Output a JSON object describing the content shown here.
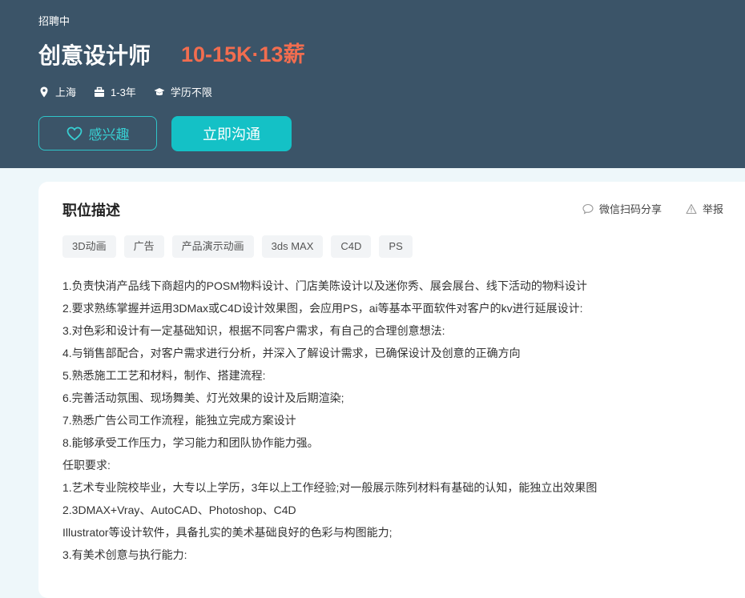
{
  "header": {
    "status": "招聘中",
    "title": "创意设计师",
    "salary": "10-15K·13薪",
    "meta": {
      "location": "上海",
      "experience": "1-3年",
      "education": "学历不限"
    },
    "interest_button": "感兴趣",
    "chat_button": "立即沟通",
    "icons": {
      "location": "location-pin-icon",
      "experience": "briefcase-icon",
      "education": "graduation-cap-icon",
      "interest": "heart-icon"
    }
  },
  "card": {
    "section_title": "职位描述",
    "actions": {
      "share": "微信扫码分享",
      "report": "举报"
    },
    "action_icons": {
      "share": "chat-bubble-icon",
      "report": "warning-triangle-icon"
    },
    "tags": [
      "3D动画",
      "广告",
      "产品演示动画",
      "3ds MAX",
      "C4D",
      "PS"
    ],
    "description": [
      "1.负责快消产品线下商超内的POSM物料设计、门店美陈设计以及迷你秀、展会展台、线下活动的物料设计",
      "2.要求熟练掌握并运用3DMax或C4D设计效果图，会应用PS，ai等基本平面软件对客户的kv进行延展设计:",
      "3.对色彩和设计有一定基础知识，根据不同客户需求，有自己的合理创意想法:",
      "4.与销售部配合，对客户需求进行分析，并深入了解设计需求，已确保设计及创意的正确方向",
      "5.熟悉施工工艺和材料，制作、搭建流程:",
      "6.完善活动氛围、现场舞美、灯光效果的设计及后期渲染;",
      "7.熟悉广告公司工作流程，能独立完成方案设计",
      "8.能够承受工作压力，学习能力和团队协作能力强。",
      "任职要求:",
      "1.艺术专业院校毕业，大专以上学历，3年以上工作经验;对一般展示陈列材料有基础的认知，能独立出效果图",
      "2.3DMAX+Vray、AutoCAD、Photoshop、C4D",
      "Illustrator等设计软件，具备扎实的美术基础良好的色彩与构图能力;",
      "3.有美术创意与执行能力:"
    ]
  },
  "colors": {
    "header_bg": "#3b5468",
    "accent": "#14c1c6",
    "salary": "#f26d4f"
  }
}
